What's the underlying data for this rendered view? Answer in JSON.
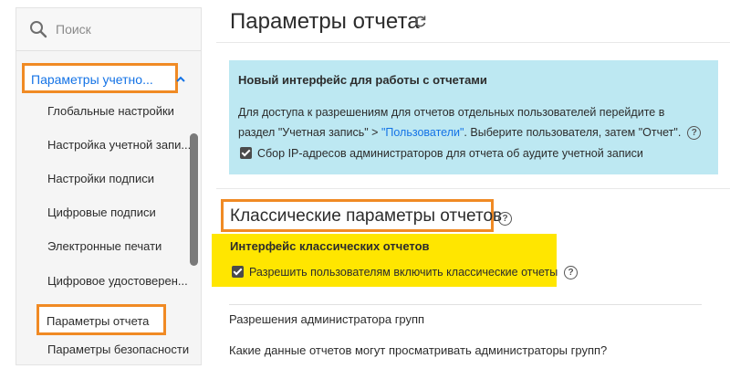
{
  "sidebar": {
    "search_placeholder": "Поиск",
    "section_label": "Параметры учетно...",
    "items": [
      {
        "label": "Глобальные настройки"
      },
      {
        "label": "Настройка учетной запи..."
      },
      {
        "label": "Настройки подписи"
      },
      {
        "label": "Цифровые подписи"
      },
      {
        "label": "Электронные печати"
      },
      {
        "label": "Цифровое удостоверен..."
      },
      {
        "label": "Параметры отчета"
      },
      {
        "label": "Параметры безопасности"
      }
    ]
  },
  "main": {
    "title": "Параметры отчета",
    "info": {
      "title": "Новый интерфейс для работы с отчетами",
      "text_before": "Для доступа к разрешениям для отчетов отдельных пользователей перейдите в раздел \"Учетная запись\" > ",
      "link": "\"Пользователи\"",
      "text_after": ". Выберите пользователя, затем \"Отчет\".",
      "checkbox_label": "Сбор IP-адресов администраторов для отчета об аудите учетной записи"
    },
    "classic": {
      "title": "Классические параметры отчетов",
      "heading": "Интерфейс классических отчетов",
      "checkbox_label": "Разрешить пользователям включить классические отчеты"
    },
    "group_admin": {
      "title": "Разрешения администратора групп",
      "question": "Какие данные отчетов могут просматривать администраторы групп?"
    }
  },
  "colors": {
    "accent": "#1473e6",
    "highlight_border": "#f08a24",
    "info_bg": "#bde8f2",
    "yellow": "#ffe600"
  }
}
